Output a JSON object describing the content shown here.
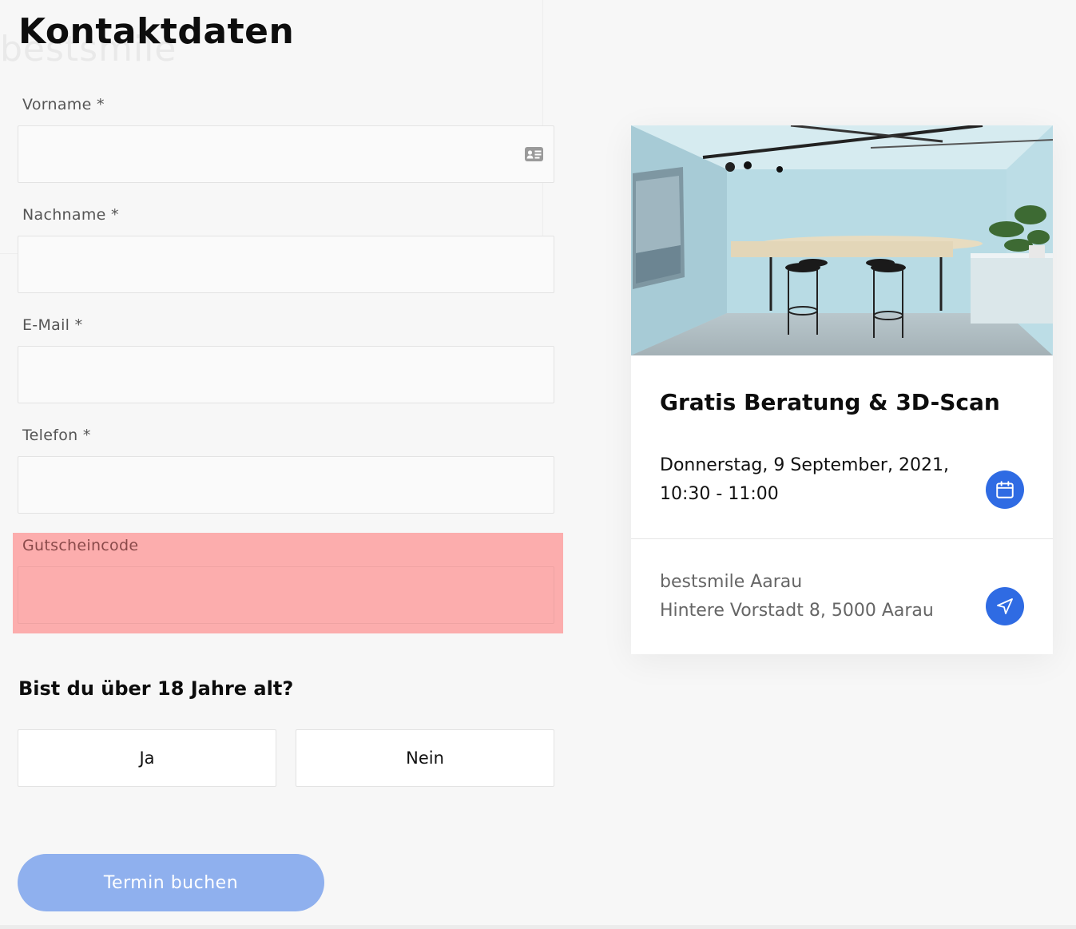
{
  "background": {
    "brand_watermark": "bestsmile"
  },
  "form": {
    "title": "Kontaktdaten",
    "fields": [
      {
        "label": "Vorname *",
        "value": "",
        "placeholder": ""
      },
      {
        "label": "Nachname *",
        "value": "",
        "placeholder": ""
      },
      {
        "label": "E-Mail *",
        "value": "",
        "placeholder": ""
      },
      {
        "label": "Telefon *",
        "value": "",
        "placeholder": ""
      },
      {
        "label": "Gutscheincode",
        "value": "",
        "placeholder": ""
      }
    ],
    "autofill_icon": "contact-card-icon",
    "age_question": "Bist du über 18 Jahre alt?",
    "age_options": [
      "Ja",
      "Nein"
    ],
    "submit_label": "Termin buchen"
  },
  "appointment": {
    "title": "Gratis Beratung & 3D-Scan",
    "date_line": "Donnerstag, 9 September, 2021,",
    "time_line": "10:30 - 11:00",
    "location_name": "bestsmile Aarau",
    "location_address": "Hintere Vorstadt 8, 5000 Aarau",
    "calendar_icon": "calendar-icon",
    "navigation_icon": "navigation-arrow-icon"
  },
  "colors": {
    "accent": "#2f6be3",
    "submit_disabled": "#8fb0ee",
    "voucher_highlight": "#fcadad",
    "page_background": "#f7f7f7"
  }
}
